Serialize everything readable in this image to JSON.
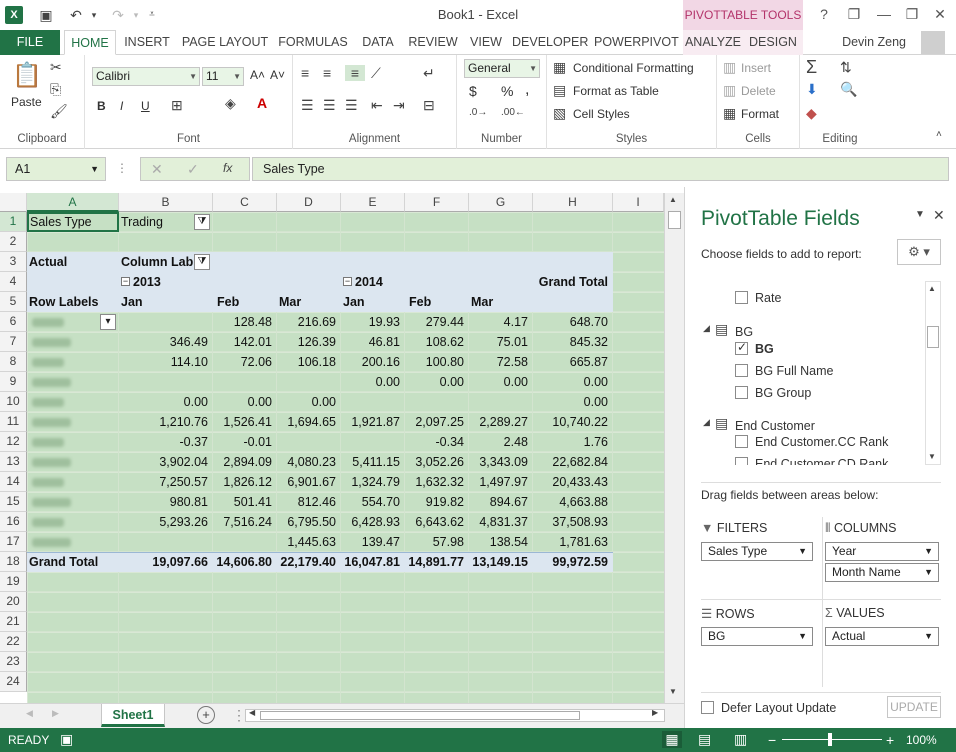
{
  "window": {
    "title": "Book1 - Excel",
    "pivot_tools": "PIVOTTABLE TOOLS",
    "help": "?",
    "min": "—",
    "restore": "❐",
    "close": "✕"
  },
  "tabs": {
    "file": "FILE",
    "home": "HOME",
    "insert": "INSERT",
    "page_layout": "PAGE LAYOUT",
    "formulas": "FORMULAS",
    "data": "DATA",
    "review": "REVIEW",
    "view": "VIEW",
    "developer": "DEVELOPER",
    "powerpivot": "POWERPIVOT",
    "analyze": "ANALYZE",
    "design": "DESIGN",
    "user": "Devin Zeng"
  },
  "ribbon": {
    "clipboard": {
      "label": "Clipboard",
      "paste": "Paste"
    },
    "font": {
      "label": "Font",
      "name": "Calibri",
      "size": "11",
      "bold": "B",
      "italic": "I",
      "underline": "U",
      "grow": "A˄",
      "shrink": "A˅"
    },
    "alignment": {
      "label": "Alignment"
    },
    "number": {
      "label": "Number",
      "format": "General",
      "currency": "$",
      "percent": "%",
      "comma": ","
    },
    "styles": {
      "label": "Styles",
      "cond": "Conditional Formatting",
      "table": "Format as Table",
      "cell": "Cell Styles"
    },
    "cells": {
      "label": "Cells",
      "insert": "Insert",
      "delete": "Delete",
      "format": "Format"
    },
    "editing": {
      "label": "Editing"
    }
  },
  "formula_bar": {
    "name_box": "A1",
    "fx": "fx",
    "content": "Sales Type"
  },
  "columns": [
    "A",
    "B",
    "C",
    "D",
    "E",
    "F",
    "G",
    "H",
    "I"
  ],
  "rows": [
    "1",
    "2",
    "3",
    "4",
    "5",
    "6",
    "7",
    "8",
    "9",
    "10",
    "11",
    "12",
    "13",
    "14",
    "15",
    "16",
    "17",
    "18",
    "19",
    "20",
    "21",
    "22",
    "23",
    "24"
  ],
  "pivot": {
    "filter_label": "Sales Type",
    "filter_value": "Trading",
    "values_label": "Actual",
    "column_labels": "Column Labels",
    "year_2013": "2013",
    "year_2014": "2014",
    "grand_total_hdr": "Grand Total",
    "row_labels": "Row Labels",
    "months": [
      "Jan",
      "Feb",
      "Mar",
      "Jan",
      "Feb",
      "Mar"
    ],
    "data_rows": [
      [
        "",
        "128.48",
        "216.69",
        "19.93",
        "279.44",
        "4.17",
        "648.70"
      ],
      [
        "346.49",
        "142.01",
        "126.39",
        "46.81",
        "108.62",
        "75.01",
        "845.32"
      ],
      [
        "114.10",
        "72.06",
        "106.18",
        "200.16",
        "100.80",
        "72.58",
        "665.87"
      ],
      [
        "",
        "",
        "",
        "0.00",
        "0.00",
        "0.00",
        "0.00"
      ],
      [
        "0.00",
        "0.00",
        "0.00",
        "",
        "",
        "",
        "0.00"
      ],
      [
        "1,210.76",
        "1,526.41",
        "1,694.65",
        "1,921.87",
        "2,097.25",
        "2,289.27",
        "10,740.22"
      ],
      [
        "-0.37",
        "-0.01",
        "",
        "",
        "-0.34",
        "2.48",
        "1.76"
      ],
      [
        "3,902.04",
        "2,894.09",
        "4,080.23",
        "5,411.15",
        "3,052.26",
        "3,343.09",
        "22,682.84"
      ],
      [
        "7,250.57",
        "1,826.12",
        "6,901.67",
        "1,324.79",
        "1,632.32",
        "1,497.97",
        "20,433.43"
      ],
      [
        "980.81",
        "501.41",
        "812.46",
        "554.70",
        "919.82",
        "894.67",
        "4,663.88"
      ],
      [
        "5,293.26",
        "7,516.24",
        "6,795.50",
        "6,428.93",
        "6,643.62",
        "4,831.37",
        "37,508.93"
      ],
      [
        "",
        "",
        "1,445.63",
        "139.47",
        "57.98",
        "138.54",
        "1,781.63"
      ]
    ],
    "grand_total_label": "Grand Total",
    "grand_total": [
      "19,097.66",
      "14,606.80",
      "22,179.40",
      "16,047.81",
      "14,891.77",
      "13,149.15",
      "99,972.59"
    ]
  },
  "sheet": {
    "tab": "Sheet1",
    "add": "+"
  },
  "panel": {
    "title": "PivotTable Fields",
    "choose": "Choose fields to add to report:",
    "fields_top": [
      {
        "label": "Rate",
        "checked": false
      }
    ],
    "table_bg": "BG",
    "bg_fields": [
      {
        "label": "BG",
        "checked": true
      },
      {
        "label": "BG Full Name",
        "checked": false
      },
      {
        "label": "BG Group",
        "checked": false
      }
    ],
    "table_end": "End Customer",
    "end_fields": [
      {
        "label": "End Customer.CC Rank",
        "checked": false
      },
      {
        "label": "End Customer.CD Rank",
        "checked": false
      }
    ],
    "drag": "Drag fields between areas below:",
    "filters": {
      "header": "FILTERS",
      "items": [
        "Sales Type"
      ]
    },
    "columns": {
      "header": "COLUMNS",
      "items": [
        "Year",
        "Month Name"
      ]
    },
    "rows": {
      "header": "ROWS",
      "items": [
        "BG"
      ]
    },
    "values": {
      "header": "VALUES",
      "items": [
        "Actual"
      ]
    },
    "defer": "Defer Layout Update",
    "update": "UPDATE"
  },
  "status": {
    "ready": "READY",
    "zoom": "100%",
    "minus": "−",
    "plus": "+"
  }
}
